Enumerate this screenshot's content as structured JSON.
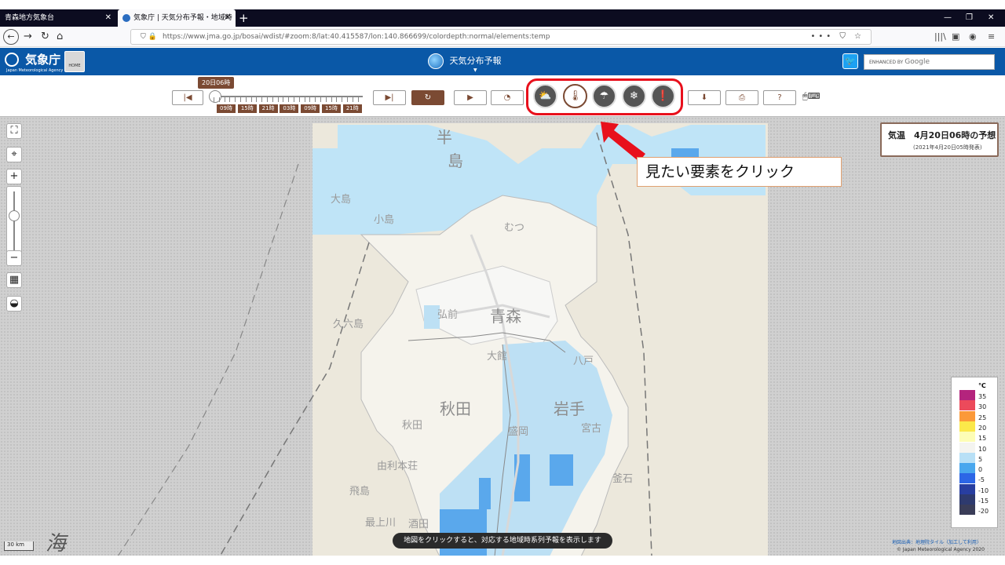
{
  "browser": {
    "tabs": [
      {
        "label": "青森地方気象台",
        "close": "✕"
      },
      {
        "label": "気象庁 | 天気分布予報・地域時",
        "close": "✕"
      }
    ],
    "new_tab": "+",
    "url": "https://www.jma.go.jp/bosai/wdist/#zoom:8/lat:40.415587/lon:140.866699/colordepth:normal/elements:temp",
    "url_domain_part": "jma.go.jp",
    "url_right_icons": "••• ⛉ ☆"
  },
  "jma": {
    "logo_text": "気象庁",
    "logo_en": "Japan Meteorological Agency",
    "home_label": "HOME",
    "page_title": "天気分布予報",
    "search_placeholder": "ENHANCED BY",
    "search_brand": "Google"
  },
  "controls": {
    "current_time": "20日06時",
    "time_ticks": [
      "09時",
      "15時",
      "21時",
      "03時",
      "09時",
      "15時",
      "21時"
    ]
  },
  "infobox": {
    "title": "気温　4月20日06時の予想",
    "subtitle": "(2021年4月20日05時発表)"
  },
  "callout": "見たい要素をクリック",
  "legend": {
    "unit": "℃",
    "items": [
      {
        "label": "35",
        "color": "#b4247d"
      },
      {
        "label": "30",
        "color": "#ec4a5b"
      },
      {
        "label": "25",
        "color": "#fb9939"
      },
      {
        "label": "20",
        "color": "#fbe84a"
      },
      {
        "label": "15",
        "color": "#fdfdb6"
      },
      {
        "label": "10",
        "color": "#f4f4f0"
      },
      {
        "label": "5",
        "color": "#b8e0f6"
      },
      {
        "label": "0",
        "color": "#49a7ee"
      },
      {
        "label": "-5",
        "color": "#2c66e6"
      },
      {
        "label": "-10",
        "color": "#283ea0"
      },
      {
        "label": "-15",
        "color": "#2e3a6e"
      },
      {
        "label": "-20",
        "color": "#3a3d58"
      }
    ]
  },
  "map": {
    "labels": {
      "hanto": "半",
      "shima": "島",
      "oshima": "大島",
      "kojima": "小島",
      "aomori": "青森",
      "hirosaki": "弘前",
      "akita_pref": "秋田",
      "iwate": "岩手",
      "akita": "秋田",
      "morioka": "盛岡",
      "miyako": "宮古",
      "kamaishi": "釜石",
      "yurihonjo": "由利本荘",
      "sakata": "酒田",
      "tobishima": "飛島",
      "mogamigawa": "最上川",
      "kunosaki": "久六島",
      "mutsu": "むつ",
      "odate": "大館",
      "hachinohe": "八戸"
    },
    "scale": "30 km",
    "sea_label": "海"
  },
  "hint": "地図をクリックすると、対応する地域時系列予報を表示します",
  "attribution": {
    "line1": "地図出典：地理院タイル（加工して利用）",
    "line2": "© Japan Meteorological Agency 2020"
  }
}
